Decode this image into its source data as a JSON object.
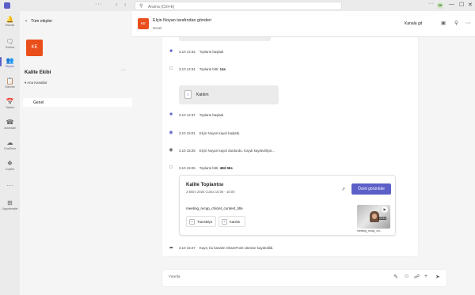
{
  "titlebar": {
    "dots": "···",
    "back_arrow": "‹",
    "forward_arrow": "›",
    "search_placeholder": "Arama (Ctrl+E)",
    "more": "···",
    "avatar_initials": "EN",
    "minimize": "—",
    "maximize": "☐",
    "close": "✕"
  },
  "rail": {
    "items": [
      {
        "label": "Etkinlik",
        "icon": "bell-icon"
      },
      {
        "label": "Sohbet",
        "icon": "chat-icon"
      },
      {
        "label": "Ekipler",
        "icon": "teams-icon"
      },
      {
        "label": "Ödevler",
        "icon": "assignments-icon"
      },
      {
        "label": "Takvim",
        "icon": "calendar-icon"
      },
      {
        "label": "Aramalar",
        "icon": "phone-icon"
      },
      {
        "label": "OneDrive",
        "icon": "cloud-icon"
      },
      {
        "label": "Copilot",
        "icon": "copilot-icon"
      },
      {
        "label": "···",
        "icon": "more-icon"
      },
      {
        "label": "Uygulamalar",
        "icon": "apps-icon"
      }
    ],
    "active": "Ekipler"
  },
  "leftpane": {
    "back_label": "Tüm ekipler",
    "team_initials": "KE",
    "team_name": "Kalite Ekibi",
    "more": "···",
    "group_label": "Ana Kanallar",
    "channel": "Genel"
  },
  "header": {
    "avatar_initials": "KE",
    "title": "Elçin Noyan tarafından gönderi",
    "subtitle": "Genel",
    "goto_channel": "Kanala git"
  },
  "events": [
    {
      "time": "3.10 14:34",
      "text": "Toplantı başladı",
      "bold": "",
      "icon": "video-icon"
    },
    {
      "time": "3.10 14:34",
      "text": "Toplantı bitti:",
      "bold": "14s",
      "icon": "video-ended-icon"
    },
    {
      "time": "3.10 14:37",
      "text": "Toplantı başladı",
      "bold": "",
      "icon": "video-icon"
    },
    {
      "time": "3.10 15:01",
      "text": "Elçin Noyan kaydı başlattı.",
      "bold": "",
      "icon": "record-icon"
    },
    {
      "time": "3.10 15:25",
      "text": "Elçin Noyan kaydı durdurdu. Kaydı kaydediliyor...",
      "bold": "",
      "icon": "record-stop-icon"
    },
    {
      "time": "3.10 15:26",
      "text": "Toplantı bitti:",
      "bold": "48d 59s",
      "icon": "video-ended-icon"
    },
    {
      "time": "3.10 15:27",
      "text": "Kayıt, bu kanalın SharePoint sitesine kaydedildi.",
      "bold": "",
      "icon": "cloud-saved-icon"
    }
  ],
  "attendance_file": {
    "label": "Katılım"
  },
  "meeting_card": {
    "title": "Kalite Toplantısı",
    "date": "3 Ekim 2025 Cuma 15:00 - 16:00",
    "button": "Özeti görüntüle",
    "recap_title": "meeting_recap_chiclet_content_title",
    "chips": [
      "Transkript",
      "Katılım"
    ],
    "thumb_duration": "23:14",
    "thumb_caption": "meeting_recap_chi..."
  },
  "compose": {
    "placeholder": "Yanıtla"
  }
}
